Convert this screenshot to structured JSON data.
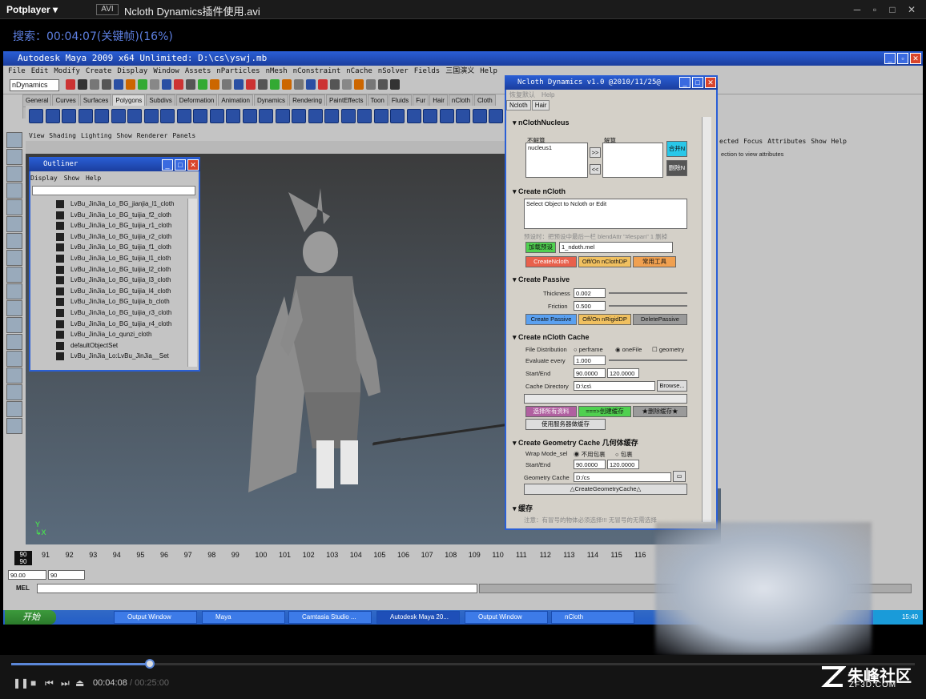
{
  "player": {
    "brand": "Potplayer ▾",
    "format": "AVI",
    "file": "Ncloth Dynamics插件使用.avi",
    "osd": "搜索：00:04:07(关键帧)(16%)",
    "progress_fraction": 0.16,
    "time_current": "00:04:08",
    "time_total": "/ 00:25:00"
  },
  "maya": {
    "title": "Autodesk Maya 2009 x64 Unlimited: D:\\cs\\yswj.mb",
    "menu": [
      "File",
      "Edit",
      "Modify",
      "Create",
      "Display",
      "Window",
      "Assets",
      "nParticles",
      "nMesh",
      "nConstraint",
      "nCache",
      "nSolver",
      "Fields",
      "三国演义",
      "Help"
    ],
    "menuset": "nDynamics",
    "shelf_tabs": [
      "General",
      "Curves",
      "Surfaces",
      "Polygons",
      "Subdivs",
      "Deformation",
      "Animation",
      "Dynamics",
      "Rendering",
      "PaintEffects",
      "Toon",
      "Fluids",
      "Fur",
      "Hair",
      "nCloth",
      "Cloth",
      "Custom"
    ],
    "shelf_active": "Polygons",
    "viewport_menu": [
      "View",
      "Shading",
      "Lighting",
      "Show",
      "Renderer",
      "Panels"
    ],
    "attr_menu": [
      "ected",
      "Focus",
      "Attributes",
      "Show",
      "Help"
    ],
    "attr_hint": "ection to view attributes",
    "timeline": {
      "current": "90",
      "current_sub": "90",
      "ticks": [
        "91",
        "92",
        "93",
        "94",
        "95",
        "96",
        "97",
        "98",
        "99",
        "100",
        "101",
        "102",
        "103",
        "104",
        "105",
        "106",
        "107",
        "108",
        "109",
        "110",
        "111",
        "112",
        "113",
        "114",
        "115",
        "116"
      ]
    },
    "range_start": "90.00",
    "range_inner": "90",
    "mel_label": "MEL"
  },
  "outliner": {
    "title": "Outliner",
    "menu": [
      "Display",
      "Show",
      "Help"
    ],
    "items": [
      "LvBu_JinJia_Lo_BG_jianjia_l1_cloth",
      "LvBu_JinJia_Lo_BG_tuijia_f2_cloth",
      "LvBu_JinJia_Lo_BG_tuijia_r1_cloth",
      "LvBu_JinJia_Lo_BG_tuijia_r2_cloth",
      "LvBu_JinJia_Lo_BG_tuijia_f1_cloth",
      "LvBu_JinJia_Lo_BG_tuijia_l1_cloth",
      "LvBu_JinJia_Lo_BG_tuijia_l2_cloth",
      "LvBu_JinJia_Lo_BG_tuijia_l3_cloth",
      "LvBu_JinJia_Lo_BG_tuijia_l4_cloth",
      "LvBu_JinJia_Lo_BG_tuijia_b_cloth",
      "LvBu_JinJia_Lo_BG_tuijia_r3_cloth",
      "LvBu_JinJia_Lo_BG_tuijia_r4_cloth",
      "LvBu_JinJia_Lo_qunzi_cloth",
      "defaultObjectSet",
      "LvBu_JinJia_Lo:LvBu_JinJia__Set"
    ]
  },
  "ncloth": {
    "title": "Ncloth Dynamics v1.0 @2010/11/25@",
    "menu": [
      "恢复默认",
      "Help"
    ],
    "tabs": [
      "Ncloth",
      "Hair"
    ],
    "nucleus": {
      "header": "nClothNucleus",
      "left_label": "不解算",
      "right_label": "解算",
      "left_item": "nucleus1",
      "move_right": ">>",
      "move_left": "<<",
      "merge": "合并N",
      "delete": "删除N"
    },
    "create": {
      "header": "Create nCloth",
      "placeholder": "Select Object to Ncloth or Edit",
      "tip": "预设时：把预设中最后一栏 blendAttr \"#lespan\" 1 删掉",
      "preset_btn": "加载预设",
      "preset_file": "1_ndoth.mel",
      "btn_create": "CreateNcloth",
      "btn_toggle": "Off/On nClothDP",
      "btn_tools": "常用工具"
    },
    "passive": {
      "header": "Create Passive",
      "thickness_label": "Thickness",
      "thickness": "0.002",
      "friction_label": "Friction",
      "friction": "0.500",
      "btn_create": "Create Passive",
      "btn_toggle": "Off/On nRigidDP",
      "btn_delete": "DeletePassive"
    },
    "cache": {
      "header": "Create nCloth Cache",
      "dist_label": "File Distribution",
      "opt1": "perframe",
      "opt2": "oneFile",
      "opt3": "geometry",
      "eval_label": "Evaluate every",
      "eval": "1.000",
      "se_label": "Start/End",
      "start": "90.0000",
      "end": "120.0000",
      "dir_label": "Cache Directory",
      "dir": "D:\\cs\\",
      "browse": "Browse...",
      "btn_select": "选择所有资料",
      "btn_create": "===>创建缓存",
      "btn_delete": "★删除缓存★",
      "btn_server": "使用服务器做缓存"
    },
    "geo": {
      "header": "Create Geometry Cache  几何体缓存",
      "wrap_label": "Wrap Mode_sel",
      "opt1": "不用包裹",
      "opt2": "包裹",
      "se_label": "Start/End",
      "start": "90.0000",
      "end": "120.0000",
      "dir_label": "Geometry Cache",
      "dir": "D:/cs",
      "btn": "△CreateGeometryCache△"
    },
    "last": {
      "header": "缓存",
      "note": "注意：有冒号的物体必须选择!!! 无冒号的无需选择"
    }
  },
  "taskbar": {
    "start": "开始",
    "tasks": [
      "Output Window",
      "Maya",
      "Camtasia Studio ...",
      "Autodesk Maya 20...",
      "Output Window",
      "nCloth"
    ],
    "clock": "15:40"
  },
  "watermark": {
    "cn": "朱峰社区",
    "en": "ZF3D.COM"
  },
  "colors": {
    "xp_blue": "#2a5fd6",
    "seek": "#5b87d8",
    "btn_red": "#e8604c",
    "btn_orange": "#f0c060",
    "btn_blue": "#5aa0f0",
    "btn_grey": "#9a9a9a",
    "btn_purple": "#b060a0",
    "btn_green": "#50d050"
  }
}
